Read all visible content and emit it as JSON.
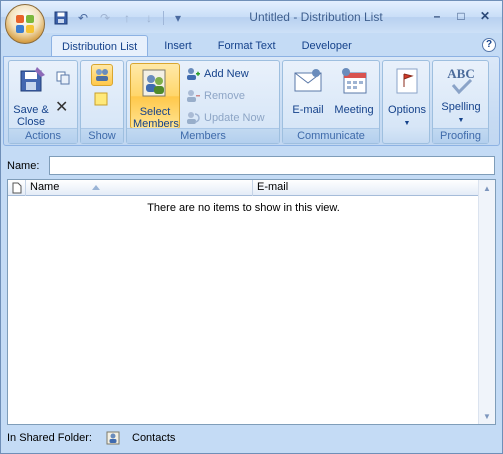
{
  "window": {
    "title": "Untitled - Distribution List",
    "controls": {
      "minimize": "–",
      "maximize": "□",
      "close": "✕"
    }
  },
  "quick_access": [
    {
      "name": "save-icon",
      "glyph": "💾"
    },
    {
      "name": "undo-icon",
      "glyph": "↶"
    },
    {
      "name": "redo-icon",
      "glyph": "↷"
    },
    {
      "name": "previous-item-icon",
      "glyph": "↑"
    },
    {
      "name": "next-item-icon",
      "glyph": "↓"
    },
    {
      "name": "customize-qat-icon",
      "glyph": "▾"
    }
  ],
  "tabs": [
    {
      "label": "Distribution List",
      "active": true
    },
    {
      "label": "Insert",
      "active": false
    },
    {
      "label": "Format Text",
      "active": false
    },
    {
      "label": "Developer",
      "active": false
    }
  ],
  "help": "?",
  "ribbon": {
    "actions": {
      "label": "Actions",
      "save_close": "Save & Close",
      "delete_icon": "✕"
    },
    "show": {
      "label": "Show"
    },
    "members": {
      "label": "Members",
      "select_members": "Select Members",
      "add_new": "Add New",
      "remove": "Remove",
      "update_now": "Update Now"
    },
    "communicate": {
      "label": "Communicate",
      "email": "E-mail",
      "meeting": "Meeting"
    },
    "options": {
      "label": "Options"
    },
    "proofing": {
      "label": "Proofing",
      "spelling": "Spelling",
      "spelling_icon_text": "ABC"
    }
  },
  "form": {
    "name_label": "Name:",
    "name_value": ""
  },
  "list": {
    "columns": [
      "Name",
      "E-mail"
    ],
    "empty_message": "There are no items to show in this view."
  },
  "status": {
    "label": "In Shared Folder:",
    "folder": "Contacts"
  },
  "colors": {
    "accent": "#15428b",
    "ribbon_bg": "#c7dbf3",
    "selected": "#ffd66a"
  }
}
